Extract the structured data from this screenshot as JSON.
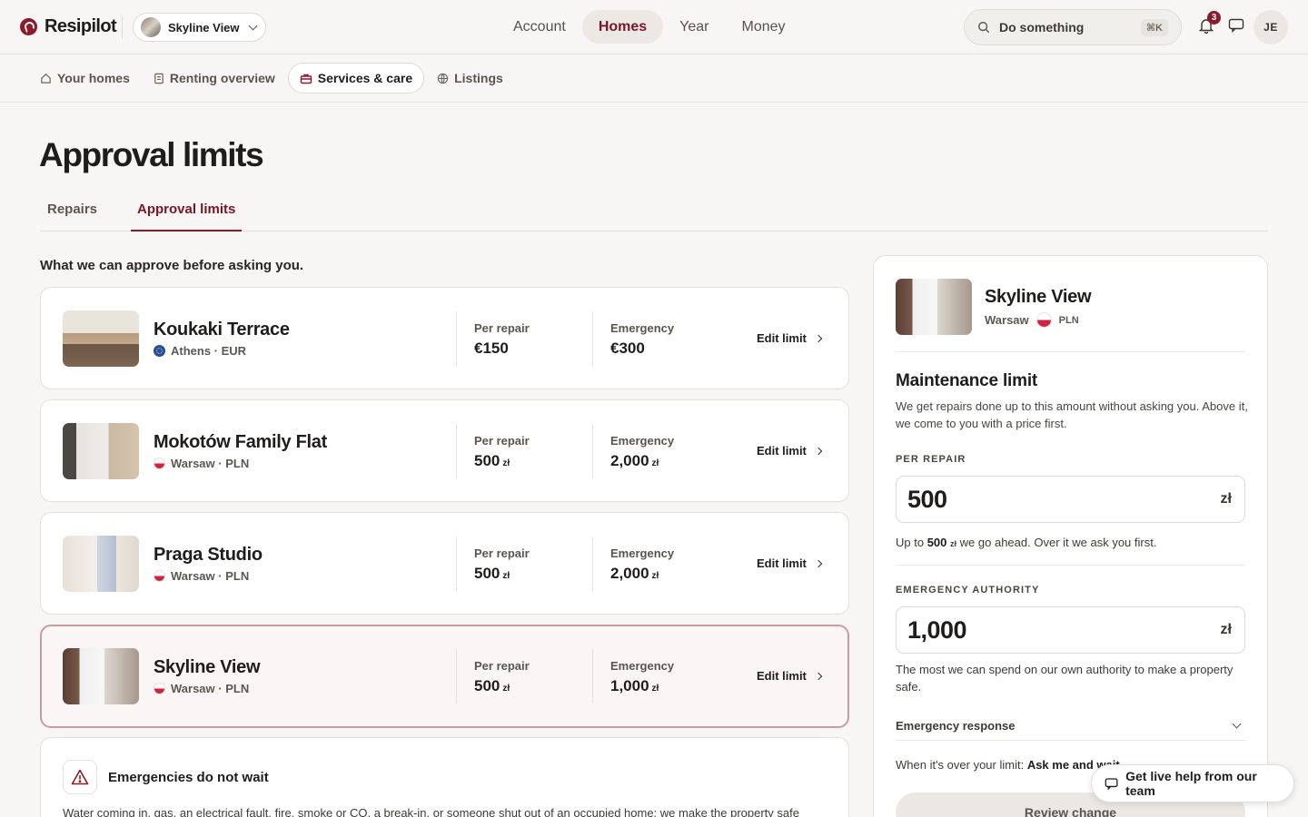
{
  "app": {
    "brand": "Resipilot",
    "home_switcher": "Skyline View",
    "nav": [
      "Account",
      "Homes",
      "Year",
      "Money"
    ],
    "active_nav": "Homes",
    "search_placeholder": "Do something",
    "search_shortcut": "⌘K",
    "notifications_count": "3",
    "user_initials": "JE"
  },
  "subnav": {
    "items": [
      "Your homes",
      "Renting overview",
      "Services & care",
      "Listings"
    ],
    "active": "Services & care"
  },
  "page": {
    "title": "Approval limits",
    "tabs": [
      "Repairs",
      "Approval limits"
    ],
    "active_tab": "Approval limits",
    "intro": "What we can approve before asking you."
  },
  "homes": [
    {
      "name": "Koukaki Terrace",
      "location": "Athens · EUR",
      "flag": "eu",
      "per_repair_label": "Per repair",
      "per_repair": "€150",
      "per_repair_cur": "",
      "emergency_label": "Emergency",
      "emergency": "€300",
      "emergency_cur": "",
      "edit": "Edit limit"
    },
    {
      "name": "Mokotów Family Flat",
      "location": "Warsaw · PLN",
      "flag": "pl",
      "per_repair_label": "Per repair",
      "per_repair": "500",
      "per_repair_cur": "zł",
      "emergency_label": "Emergency",
      "emergency": "2,000",
      "emergency_cur": "zł",
      "edit": "Edit limit"
    },
    {
      "name": "Praga Studio",
      "location": "Warsaw · PLN",
      "flag": "pl",
      "per_repair_label": "Per repair",
      "per_repair": "500",
      "per_repair_cur": "zł",
      "emergency_label": "Emergency",
      "emergency": "2,000",
      "emergency_cur": "zł",
      "edit": "Edit limit"
    },
    {
      "name": "Skyline View",
      "location": "Warsaw · PLN",
      "flag": "pl",
      "per_repair_label": "Per repair",
      "per_repair": "500",
      "per_repair_cur": "zł",
      "emergency_label": "Emergency",
      "emergency": "1,000",
      "emergency_cur": "zł",
      "edit": "Edit limit",
      "selected": true
    }
  ],
  "emergency_notice": {
    "title": "Emergencies do not wait",
    "text": "Water coming in, gas, an electrical fault, fire, smoke or CO, a break-in, or someone shut out of an occupied home: we make the property safe"
  },
  "panel": {
    "home_name": "Skyline View",
    "city": "Warsaw",
    "currency_code": "PLN",
    "section_title": "Maintenance limit",
    "section_desc": "We get repairs done up to this amount without asking you. Above it, we come to you with a price first.",
    "per_repair_label": "PER REPAIR",
    "per_repair_value": "500",
    "currency_symbol": "zł",
    "per_repair_hint_pre": "Up to",
    "per_repair_hint_amount": "500",
    "per_repair_hint_post": "we go ahead. Over it we ask you first.",
    "emergency_label": "EMERGENCY AUTHORITY",
    "emergency_value": "1,000",
    "emergency_hint": "The most we can spend on our own authority to make a property safe.",
    "emergency_response": "Emergency response",
    "over_limit_pre": "When it's over your limit:",
    "over_limit_value": "Ask me and wait",
    "review_button": "Review change"
  },
  "help": {
    "label": "Get live help from our team"
  },
  "colors": {
    "accent": "#8b1a2a",
    "background": "#f7f6f4",
    "selected_border": "#c99aa1"
  }
}
